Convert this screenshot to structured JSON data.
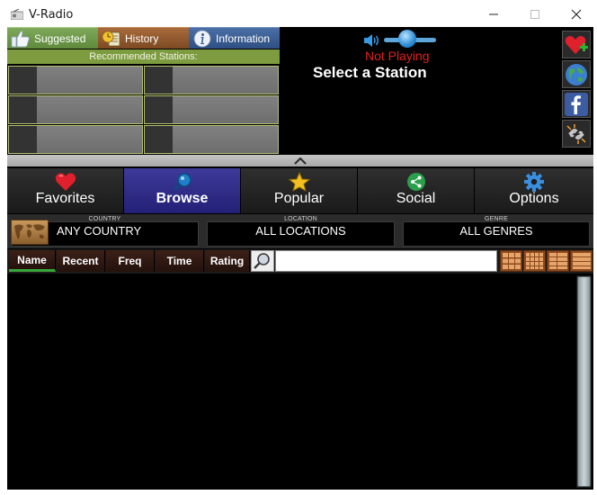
{
  "window": {
    "title": "V-Radio"
  },
  "top_tabs": [
    {
      "label": "Suggested",
      "icon": "thumbs-up-icon",
      "color": "#6f9a48"
    },
    {
      "label": "History",
      "icon": "history-icon",
      "color": "#8e5a2e"
    },
    {
      "label": "Information",
      "icon": "info-icon",
      "color": "#3a5f96"
    }
  ],
  "recommended": {
    "header": "Recommended Stations:",
    "slot_count": 6
  },
  "player": {
    "status": "Not Playing",
    "title": "Select a Station",
    "volume": 0.45,
    "status_color": "#e02020"
  },
  "side_buttons": [
    {
      "icon": "add-favorite-icon"
    },
    {
      "icon": "globe-icon"
    },
    {
      "icon": "facebook-icon"
    },
    {
      "icon": "broken-link-icon"
    }
  ],
  "main_tabs": [
    {
      "label": "Favorites",
      "icon": "heart-icon",
      "active": false
    },
    {
      "label": "Browse",
      "icon": "search-icon",
      "active": true
    },
    {
      "label": "Popular",
      "icon": "star-icon",
      "active": false
    },
    {
      "label": "Social",
      "icon": "share-icon",
      "active": false
    },
    {
      "label": "Options",
      "icon": "gear-icon",
      "active": false
    }
  ],
  "filters": {
    "country": {
      "label": "COUNTRY",
      "value": "ANY COUNTRY"
    },
    "location": {
      "label": "LOCATION",
      "value": "ALL LOCATIONS"
    },
    "genre": {
      "label": "GENRE",
      "value": "ALL GENRES"
    }
  },
  "sort_columns": [
    {
      "label": "Name",
      "active": true
    },
    {
      "label": "Recent",
      "active": false
    },
    {
      "label": "Freq",
      "active": false
    },
    {
      "label": "Time",
      "active": false
    },
    {
      "label": "Rating",
      "active": false
    }
  ],
  "search": {
    "value": "",
    "placeholder": ""
  },
  "view_modes": [
    {
      "icon": "grid-large-icon"
    },
    {
      "icon": "grid-small-icon"
    },
    {
      "icon": "list-detail-icon"
    },
    {
      "icon": "list-icon"
    }
  ],
  "colors": {
    "accent_active_tab": "#2f2c8a",
    "sort_active": "#3aa63a"
  }
}
